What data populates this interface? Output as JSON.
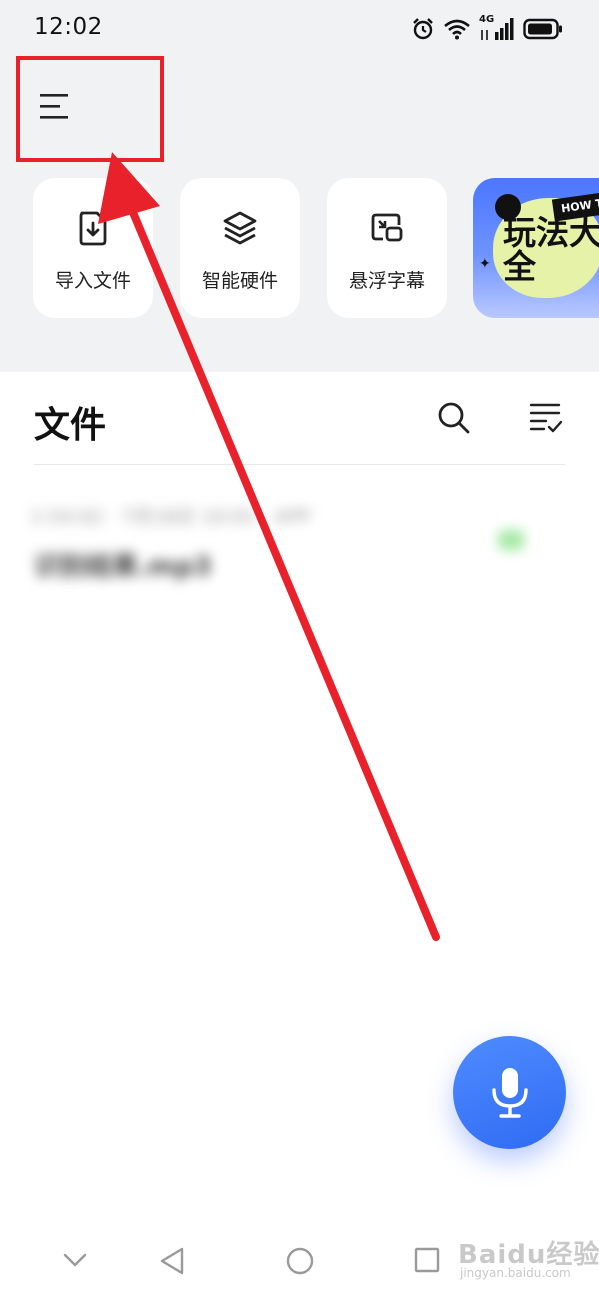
{
  "status_bar": {
    "time": "12:02",
    "network": "4G",
    "icons": [
      "alarm-icon",
      "wifi-icon",
      "signal-icon",
      "battery-icon"
    ]
  },
  "header": {
    "menu_icon": "menu-icon",
    "highlight_color": "#e8212b"
  },
  "quick_actions": [
    {
      "label": "导入文件",
      "icon": "file-import-icon"
    },
    {
      "label": "智能硬件",
      "icon": "layers-icon"
    },
    {
      "label": "悬浮字幕",
      "icon": "floating-window-icon"
    }
  ],
  "promo": {
    "title": "玩法大全",
    "tag": "HOW TO",
    "colors": {
      "background": "#4b76ff",
      "blob": "#e5f2a8"
    }
  },
  "files": {
    "title": "文件",
    "search_icon": "search-icon",
    "sort_icon": "list-check-icon",
    "items": [
      {
        "meta": "1:54:02 · 7月18日 10:01 · APP",
        "name": "识别结果.mp3"
      }
    ]
  },
  "fab": {
    "icon": "microphone-icon",
    "color": "#3a78f5"
  },
  "nav": [
    "chevron-down-icon",
    "back-icon",
    "home-icon",
    "recents-icon"
  ],
  "watermark": {
    "main": "Baidu经验",
    "sub": "jingyan.baidu.com"
  }
}
